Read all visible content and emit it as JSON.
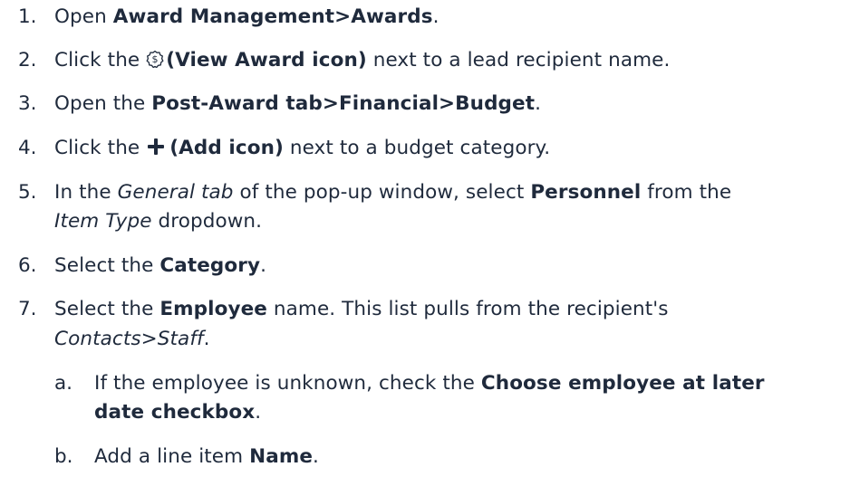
{
  "steps": [
    {
      "num": "1.",
      "parts": {
        "t1": "Open ",
        "b1": "Award Management>Awards",
        "t2": "."
      }
    },
    {
      "num": "2.",
      "parts": {
        "t1": "Click the ",
        "icon": "view-award-icon",
        "b1": "(View Award icon)",
        "t2": " next to a lead recipient name."
      }
    },
    {
      "num": "3.",
      "parts": {
        "t1": "Open the ",
        "b1": "Post-Award tab>Financial>Budget",
        "t2": "."
      }
    },
    {
      "num": "4.",
      "parts": {
        "t1": "Click the ",
        "icon": "add-icon",
        "b1": "(Add icon)",
        "t2": " next to a budget category."
      }
    },
    {
      "num": "5.",
      "parts": {
        "t1": "In the ",
        "i1": "General tab",
        "t2": " of the pop-up window, select ",
        "b1": "Personnel",
        "t3": " from the",
        "i2": "Item Type",
        "t4": " dropdown."
      }
    },
    {
      "num": "6.",
      "parts": {
        "t1": "Select the ",
        "b1": "Category",
        "t2": "."
      }
    },
    {
      "num": "7.",
      "parts": {
        "t1": "Select the ",
        "b1": "Employee",
        "t2": " name. This list pulls from the recipient's",
        "i1": "Contacts>Staff",
        "t3": "."
      }
    }
  ],
  "substeps": [
    {
      "letter": "a.",
      "parts": {
        "t1": "If the employee is unknown, check the ",
        "b1": "Choose employee at later",
        "b2": "date checkbox",
        "t2": "."
      }
    },
    {
      "letter": "b.",
      "parts": {
        "t1": "Add a line item ",
        "b1": "Name",
        "t2": "."
      }
    }
  ]
}
